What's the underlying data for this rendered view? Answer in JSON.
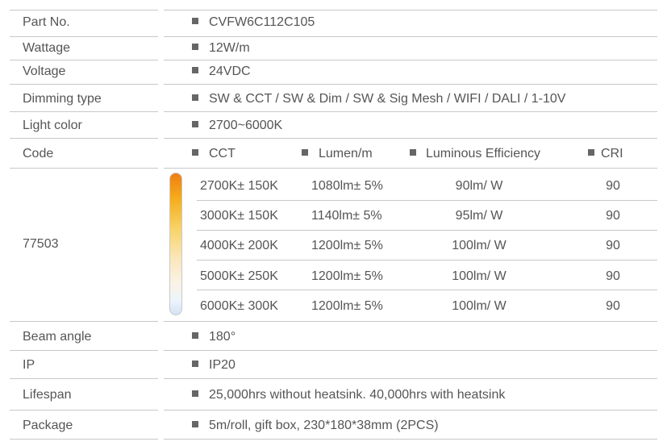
{
  "rows": {
    "part_no": {
      "label": "Part  No.",
      "value": "CVFW6C112C105"
    },
    "wattage": {
      "label": "Wattage",
      "value": "12W/m"
    },
    "voltage": {
      "label": "Voltage",
      "value": "24VDC"
    },
    "dimming": {
      "label": "Dimming type",
      "value": "SW & CCT /  SW & Dim / SW & Sig Mesh / WIFI / DALI / 1-10V"
    },
    "light_color": {
      "label": "Light color",
      "value": "2700~6000K"
    },
    "code": {
      "label": "Code",
      "value": "77503"
    },
    "beam_angle": {
      "label": "Beam angle",
      "value": "180°"
    },
    "ip": {
      "label": "IP",
      "value": "IP20"
    },
    "lifespan": {
      "label": "Lifespan",
      "value": "25,000hrs without heatsink. 40,000hrs with heatsink"
    },
    "package": {
      "label": "Package",
      "value": "5m/roll, gift box, 230*180*38mm (2PCS)"
    }
  },
  "cct_table": {
    "headers": [
      "CCT",
      "Lumen/m",
      "Luminous Efficiency",
      "CRI"
    ],
    "rows": [
      [
        "2700K± 150K",
        "1080lm± 5%",
        "90lm/ W",
        "90"
      ],
      [
        "3000K± 150K",
        "1140lm± 5%",
        "95lm/ W",
        "90"
      ],
      [
        "4000K± 200K",
        "1200lm± 5%",
        "100lm/ W",
        "90"
      ],
      [
        "5000K± 250K",
        "1200lm± 5%",
        "100lm/ W",
        "90"
      ],
      [
        "6000K± 300K",
        "1200lm± 5%",
        "100lm/ W",
        "90"
      ]
    ]
  },
  "colors": {
    "text": "#555555",
    "rule": "#c8c8c8",
    "bullet": "#666666",
    "warm": "#f07d12",
    "cool": "#d3e3f5"
  }
}
